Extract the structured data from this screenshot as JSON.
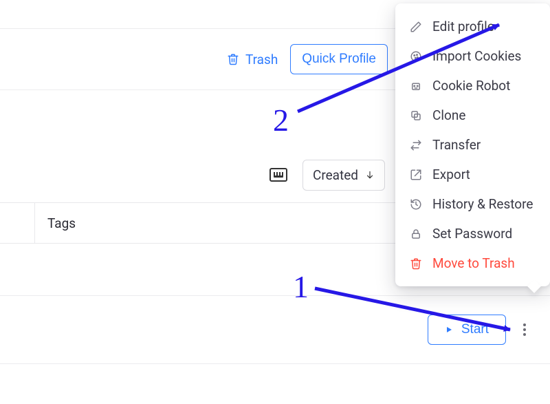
{
  "toolbar": {
    "trash_label": "Trash",
    "quick_profile_label": "Quick Profile"
  },
  "sort": {
    "label": "Created",
    "direction": "desc"
  },
  "columns": {
    "tags": "Tags"
  },
  "row": {
    "start_label": "Start"
  },
  "menu": {
    "items": [
      {
        "id": "edit-profile",
        "label": "Edit profile",
        "icon": "pencil-icon",
        "danger": false
      },
      {
        "id": "import-cookies",
        "label": "Import Cookies",
        "icon": "cookie-icon",
        "danger": false
      },
      {
        "id": "cookie-robot",
        "label": "Cookie Robot",
        "icon": "robot-icon",
        "danger": false
      },
      {
        "id": "clone",
        "label": "Clone",
        "icon": "copy-icon",
        "danger": false
      },
      {
        "id": "transfer",
        "label": "Transfer",
        "icon": "transfer-icon",
        "danger": false
      },
      {
        "id": "export",
        "label": "Export",
        "icon": "export-icon",
        "danger": false
      },
      {
        "id": "history-restore",
        "label": "History & Restore",
        "icon": "history-icon",
        "danger": false
      },
      {
        "id": "set-password",
        "label": "Set Password",
        "icon": "lock-icon",
        "danger": false
      },
      {
        "id": "move-to-trash",
        "label": "Move to Trash",
        "icon": "trash-icon",
        "danger": true
      }
    ]
  },
  "annotations": {
    "step1": "1",
    "step2": "2"
  },
  "colors": {
    "accent": "#2f7cff",
    "danger": "#ff4a3d",
    "annotation": "#2618e6"
  }
}
